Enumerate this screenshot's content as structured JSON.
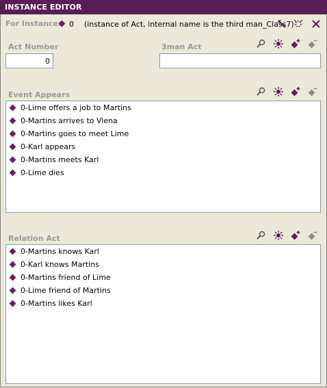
{
  "window": {
    "title": "INSTANCE EDITOR"
  },
  "instance": {
    "label": "For Instance:",
    "id": "0",
    "description": "(instance of Act, internal name is the third man_Class7)"
  },
  "act_number": {
    "label": "Act Number",
    "value": "0"
  },
  "man_act": {
    "label": "3man Act",
    "value": ""
  },
  "event_appears": {
    "label": "Event Appears",
    "items": [
      "0-Lime offers a job to Martins",
      "0-Martins arrives to Viena",
      "0-Martins goes to meet Lime",
      "0-Karl appears",
      "0-Martins meets Karl",
      "0-Lime dies"
    ]
  },
  "relation_act": {
    "label": "Relation Act",
    "items": [
      "0-Martins knows Karl",
      "0-Karl knows Martins",
      "0-Martins friend of Lime",
      "0-Lime friend of Martins",
      "0-Martins likes Karl"
    ]
  },
  "colors": {
    "title_bg": "#5a1e56",
    "instance_diamond": "#6b1f5e",
    "panel_bg": "#ece9d8"
  },
  "icons": {
    "header": [
      "edit-icon",
      "settings-icon",
      "close-icon"
    ],
    "section": [
      "view-icon",
      "create-icon",
      "add-icon",
      "remove-icon"
    ]
  }
}
